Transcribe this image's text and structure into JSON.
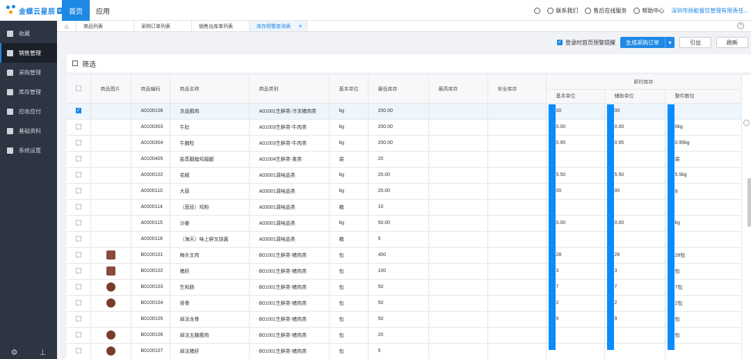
{
  "brand": {
    "name": "金蝶云星辰",
    "badge": "标准版"
  },
  "topnav": {
    "home": "首页",
    "app": "应用"
  },
  "topright": {
    "contact": "联系我们",
    "service": "售后在线服务",
    "help": "帮助中心",
    "company": "深圳市扬能餐饮管理有限责任..."
  },
  "sidebar": [
    {
      "label": "收藏",
      "icon": "star-icon"
    },
    {
      "label": "销售管理",
      "icon": "chart-icon"
    },
    {
      "label": "采购管理",
      "icon": "cart-icon"
    },
    {
      "label": "库存管理",
      "icon": "box-icon"
    },
    {
      "label": "应收应付",
      "icon": "money-icon"
    },
    {
      "label": "基础资料",
      "icon": "layers-icon"
    },
    {
      "label": "系统设置",
      "icon": "gear-icon"
    }
  ],
  "tabs": [
    "商品列表",
    "采购订单列表",
    "销售出库单列表",
    "库存预警查询表"
  ],
  "toolbar": {
    "checkbox_label": "登录时首页预警提醒",
    "generate_btn": "生成采购订单",
    "export_btn": "引出",
    "refresh_btn": "刷新"
  },
  "filter": {
    "label": "筛选"
  },
  "table": {
    "headers": [
      "商品图片",
      "商品编码",
      "商品名称",
      "商品类别",
      "基本单位",
      "最低库存",
      "最高库存",
      "安全库存"
    ],
    "group_header": "即时库存",
    "sub_headers": [
      "基本单位",
      "辅助单位",
      "整件散包"
    ],
    "rows": [
      {
        "code": "A0100106",
        "name": "冻品鹅肉",
        "cat": "A01001生鲜类-冷冻猪肉类",
        "unit": "kg",
        "min": "200.00",
        "s1": "00",
        "s2": "00",
        "s3": "",
        "checked": true,
        "img": ""
      },
      {
        "code": "A0100303",
        "name": "牛肚",
        "cat": "A01003生鲜类-牛肉类",
        "unit": "kg",
        "min": "200.00",
        "s1": "0.00",
        "s2": "0.00",
        "s3": "0kg",
        "checked": false,
        "img": ""
      },
      {
        "code": "A0100304",
        "name": "牛腩粒",
        "cat": "A01003生鲜类-牛肉类",
        "unit": "kg",
        "min": "200.00",
        "s1": "0.95",
        "s2": "0.95",
        "s3": "0.95kg",
        "checked": false,
        "img": ""
      },
      {
        "code": "A0100405",
        "name": "盐蒸胭脂鸡翅腿",
        "cat": "A01004生鲜类-禽类",
        "unit": "袋",
        "min": "20",
        "s1": "",
        "s2": "",
        "s3": "袋",
        "checked": false,
        "img": ""
      },
      {
        "code": "A0300102",
        "name": "花椒",
        "cat": "A03001调味品类",
        "unit": "kg",
        "min": "20.00",
        "s1": "5.50",
        "s2": "5.50",
        "s3": "5.5kg",
        "checked": false,
        "img": ""
      },
      {
        "code": "A0300110",
        "name": "大蒜",
        "cat": "A03001调味品类",
        "unit": "kg",
        "min": "20.00",
        "s1": "00",
        "s2": "00",
        "s3": "g",
        "checked": false,
        "img": ""
      },
      {
        "code": "A0300114",
        "name": "（葱段）鸡粉",
        "cat": "A03001调味品类",
        "unit": "箱",
        "min": "10",
        "s1": "",
        "s2": "",
        "s3": "",
        "checked": false,
        "img": ""
      },
      {
        "code": "A0300115",
        "name": "沙姜",
        "cat": "A03001调味品类",
        "unit": "kg",
        "min": "50.00",
        "s1": "0.00",
        "s2": "0.00",
        "s3": "kg",
        "checked": false,
        "img": ""
      },
      {
        "code": "A0300118",
        "name": "（海天）味上鲜叉烧酱",
        "cat": "A03001调味品类",
        "unit": "箱",
        "min": "5",
        "s1": "",
        "s2": "",
        "s3": "",
        "checked": false,
        "img": ""
      },
      {
        "code": "B0100101",
        "name": "梅头叉肉",
        "cat": "B01001生鲜类-猪肉类",
        "unit": "包",
        "min": "400",
        "s1": "28",
        "s2": "28",
        "s3": "28包",
        "checked": false,
        "img": "sq"
      },
      {
        "code": "B0100102",
        "name": "猪肝",
        "cat": "B01001生鲜类-猪肉类",
        "unit": "包",
        "min": "100",
        "s1": "3",
        "s2": "3",
        "s3": "包",
        "checked": false,
        "img": "sq"
      },
      {
        "code": "B0100103",
        "name": "生和肠",
        "cat": "B01001生鲜类-猪肉类",
        "unit": "包",
        "min": "50",
        "s1": "7",
        "s2": "7",
        "s3": "7包",
        "checked": false,
        "img": "round"
      },
      {
        "code": "B0100104",
        "name": "肾骨",
        "cat": "B01001生鲜类-猪肉类",
        "unit": "包",
        "min": "50",
        "s1": "2",
        "s2": "2",
        "s3": "2包",
        "checked": false,
        "img": "round"
      },
      {
        "code": "B0100105",
        "name": "焯法龙骨",
        "cat": "B01001生鲜类-猪肉类",
        "unit": "包",
        "min": "50",
        "s1": "9",
        "s2": "9",
        "s3": "包",
        "checked": false,
        "img": ""
      },
      {
        "code": "B0100106",
        "name": "焯法五腩瘦肉",
        "cat": "B01001生鲜类-猪肉类",
        "unit": "包",
        "min": "20",
        "s1": "",
        "s2": "",
        "s3": "包",
        "checked": false,
        "img": "round"
      },
      {
        "code": "B0100107",
        "name": "焯法猪肝",
        "cat": "B01001生鲜类-猪肉类",
        "unit": "包",
        "min": "5",
        "s1": "",
        "s2": "",
        "s3": "",
        "checked": false,
        "img": "round"
      }
    ]
  },
  "colors": {
    "accent": "#1e88e5",
    "sidebar_bg": "#2d3442",
    "redaction": "#0a8cff"
  }
}
